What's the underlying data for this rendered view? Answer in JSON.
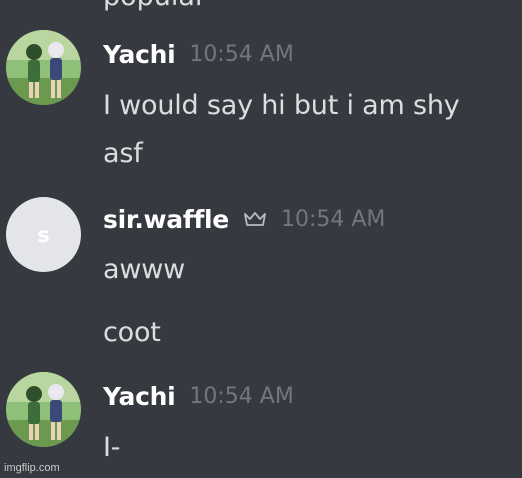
{
  "cut_off_text": "popular",
  "messages": [
    {
      "username": "Yachi",
      "timestamp": "10:54 AM",
      "lines": [
        "I would say hi but i am shy",
        "asf"
      ]
    },
    {
      "username": "sir.waffle",
      "avatar_initial": "s",
      "badge_icon": "crown-icon",
      "timestamp": "10:54 AM",
      "lines": [
        "awww",
        "coot"
      ]
    },
    {
      "username": "Yachi",
      "timestamp": "10:54 AM",
      "lines": [
        "I-"
      ]
    }
  ],
  "watermark": "imgflip.com",
  "colors": {
    "background": "#36393f",
    "username": "#ffffff",
    "message_text": "#dcddde",
    "timestamp": "#72767d",
    "avatar_placeholder": "#e3e5e8"
  }
}
